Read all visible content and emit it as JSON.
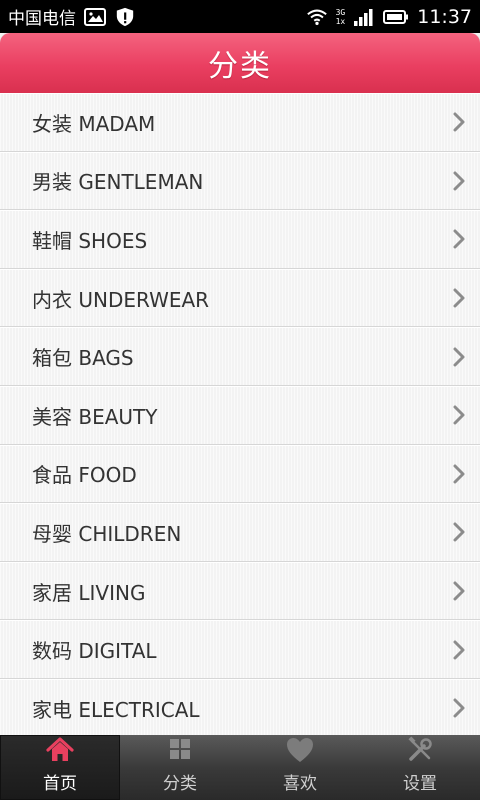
{
  "status_bar": {
    "carrier": "中国电信",
    "network_top": "3G",
    "network_bottom": "1x",
    "time": "11:37",
    "icons": [
      "image-icon",
      "shield-icon",
      "wifi-icon",
      "signal-icon",
      "battery-icon"
    ]
  },
  "header": {
    "title": "分类"
  },
  "categories": [
    {
      "label": "女装 MADAM"
    },
    {
      "label": "男装 GENTLEMAN"
    },
    {
      "label": "鞋帽 SHOES"
    },
    {
      "label": "内衣 UNDERWEAR"
    },
    {
      "label": "箱包 BAGS"
    },
    {
      "label": "美容 BEAUTY"
    },
    {
      "label": "食品 FOOD"
    },
    {
      "label": "母婴 CHILDREN"
    },
    {
      "label": "家居 LIVING"
    },
    {
      "label": "数码 DIGITAL"
    },
    {
      "label": "家电 ELECTRICAL"
    }
  ],
  "tabs": [
    {
      "label": "首页",
      "icon": "home-icon",
      "active": true
    },
    {
      "label": "分类",
      "icon": "grid-icon",
      "active": false
    },
    {
      "label": "喜欢",
      "icon": "heart-icon",
      "active": false
    },
    {
      "label": "设置",
      "icon": "tools-icon",
      "active": false
    }
  ],
  "colors": {
    "accent": "#ea3f61",
    "active_tab_icon": "#e8405f"
  }
}
